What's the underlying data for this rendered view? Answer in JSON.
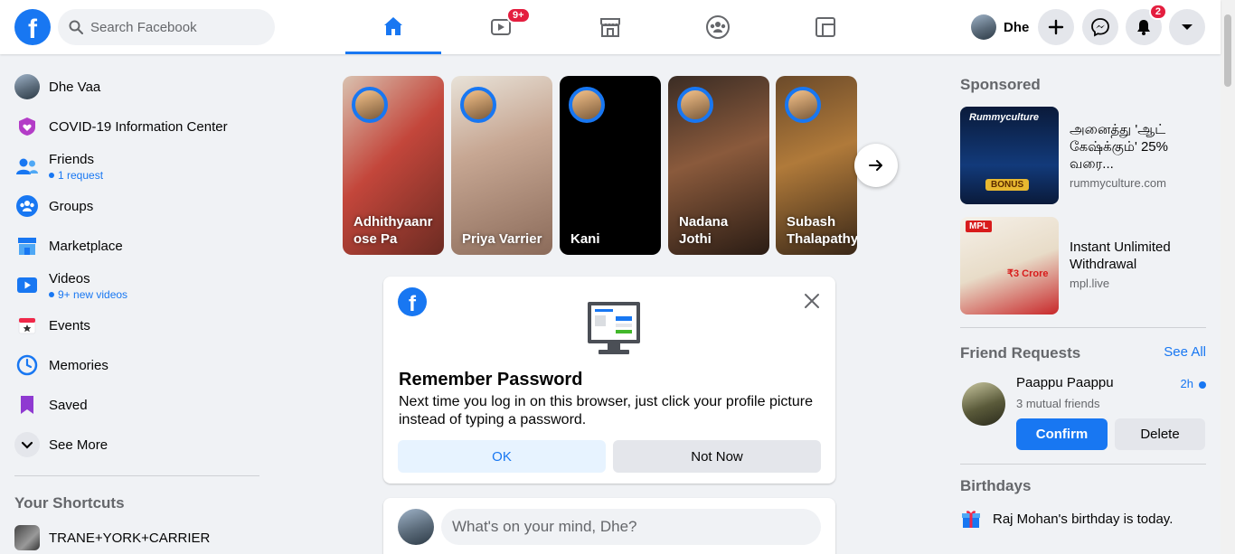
{
  "topbar": {
    "logo": "f",
    "search_placeholder": "Search Facebook",
    "tabs": [
      {
        "name": "home-icon"
      },
      {
        "name": "video-icon",
        "badge": "9+"
      },
      {
        "name": "marketplace-icon"
      },
      {
        "name": "groups-icon"
      },
      {
        "name": "gaming-icon"
      }
    ],
    "user_name": "Dhe",
    "notifications_badge": "2"
  },
  "sidebar": {
    "items": [
      {
        "label": "Dhe Vaa",
        "icon": "profile-avatar"
      },
      {
        "label": "COVID-19 Information Center",
        "icon": "covid-heart-icon"
      },
      {
        "label": "Friends",
        "sub": "1 request",
        "icon": "friends-icon"
      },
      {
        "label": "Groups",
        "icon": "groups-icon"
      },
      {
        "label": "Marketplace",
        "icon": "marketplace-icon"
      },
      {
        "label": "Videos",
        "sub": "9+ new videos",
        "icon": "video-icon"
      },
      {
        "label": "Events",
        "icon": "calendar-icon"
      },
      {
        "label": "Memories",
        "icon": "clock-icon"
      },
      {
        "label": "Saved",
        "icon": "bookmark-icon"
      },
      {
        "label": "See More",
        "icon": "chevron-down-icon"
      }
    ],
    "shortcuts_heading": "Your Shortcuts",
    "shortcuts": [
      "TRANE+YORK+CARRIER"
    ]
  },
  "stories": [
    {
      "name": "Adhithyaanr ose Pa"
    },
    {
      "name": "Priya Varrier"
    },
    {
      "name": "Kani"
    },
    {
      "name": "Nadana Jothi"
    },
    {
      "name": "Subash Thalapathy"
    }
  ],
  "remember_password": {
    "title": "Remember Password",
    "body": "Next time you log in on this browser, just click your profile picture instead of typing a password.",
    "ok": "OK",
    "not_now": "Not Now"
  },
  "composer": {
    "placeholder": "What's on your mind, Dhe?"
  },
  "right": {
    "sponsored_heading": "Sponsored",
    "ads": [
      {
        "headline": "அனைத்து 'ஆட் கேஷ்க்கும்' 25% வரை...",
        "domain": "rummyculture.com",
        "image_text": "Rummyculture",
        "image_badge": "BONUS"
      },
      {
        "headline": "Instant Unlimited Withdrawal",
        "domain": "mpl.live",
        "image_text": "MPL",
        "image_badge": "₹3 Crore"
      }
    ],
    "friend_requests_heading": "Friend Requests",
    "see_all": "See All",
    "request": {
      "name": "Paappu Paappu",
      "time": "2h",
      "mutual": "3 mutual friends",
      "confirm": "Confirm",
      "delete": "Delete"
    },
    "birthdays_heading": "Birthdays",
    "birthday": {
      "name": "Raj Mohan",
      "text": "'s birthday is today."
    }
  }
}
